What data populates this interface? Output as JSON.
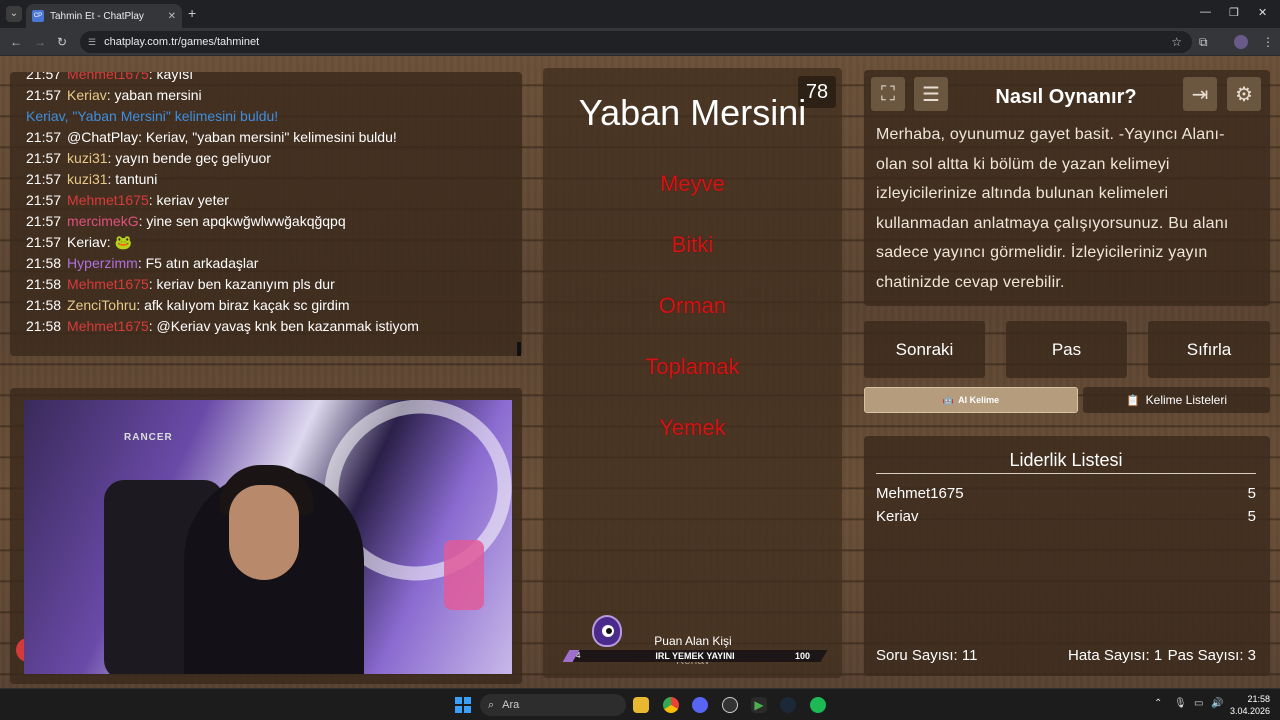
{
  "browser": {
    "tab_title": "Tahmin Et - ChatPlay",
    "favicon_text": "CP",
    "url": "chatplay.com.tr/games/tahminet"
  },
  "chat": {
    "lines": [
      {
        "time": "21:57",
        "user": "Mehmet1675",
        "user_color": "#d93b3b",
        "text": ": kayısı"
      },
      {
        "time": "21:57",
        "user": "Keriav",
        "user_color": "#e8c98a",
        "text": ": yaban mersini"
      },
      {
        "time": "",
        "user": "",
        "user_color": "#3e8fe0",
        "text": "Keriav, \"Yaban Mersini\" kelimesini buldu!",
        "highlight": "#3e8fe0"
      },
      {
        "time": "21:57",
        "user": "",
        "user_color": "#ffffff",
        "text": "@ChatPlay: Keriav, \"yaban mersini\" kelimesini buldu!"
      },
      {
        "time": "21:57",
        "user": "kuzi31",
        "user_color": "#e8c98a",
        "text": ": yayın bende geç geliyuor"
      },
      {
        "time": "21:57",
        "user": "kuzi31",
        "user_color": "#e8c98a",
        "text": ": tantuni"
      },
      {
        "time": "21:57",
        "user": "Mehmet1675",
        "user_color": "#d93b3b",
        "text": ": keriav yeter"
      },
      {
        "time": "21:57",
        "user": "mercimekG",
        "user_color": "#e05080",
        "text": ": yine sen apqkwğwlwwğakqğqpq"
      },
      {
        "time": "21:57",
        "user": "Keriav",
        "user_color": "#ffffff",
        "text": ": 🐸"
      },
      {
        "time": "21:58",
        "user": "Hyperzimm",
        "user_color": "#b070e0",
        "text": ": F5 atın arkadaşlar"
      },
      {
        "time": "21:58",
        "user": "Mehmet1675",
        "user_color": "#d93b3b",
        "text": ": keriav ben kazanıyım pls dur"
      },
      {
        "time": "21:58",
        "user": "ZenciTohru",
        "user_color": "#e8c98a",
        "text": ": afk kalıyom biraz kaçak sc girdim"
      },
      {
        "time": "21:58",
        "user": "Mehmet1675",
        "user_color": "#d93b3b",
        "text": ": @Keriav yavaş knk ben kazanmak istiyom"
      }
    ]
  },
  "camera": {
    "chair_brand": "RANCER"
  },
  "game": {
    "timer": "78",
    "word": "Yaban Mersini",
    "forbidden": [
      "Meyve",
      "Bitki",
      "Orman",
      "Toplamak",
      "Yemek"
    ],
    "forbidden_color": "#d01616",
    "scorer_label": "Puan Alan Kişi",
    "scorer_name": "Keriav",
    "bar_left": "4",
    "bar_title": "IRL YEMEK YAYINI",
    "bar_right": "100",
    "bar_progress": 0.04
  },
  "howto": {
    "title": "Nasıl Oynanır?",
    "text": "Merhaba, oyunumuz gayet basit. -Yayıncı Alanı- olan sol altta ki bölüm de yazan kelimeyi izleyicilerinize altında bulunan kelimeleri kullanmadan anlatmaya çalışıyorsunuz. Bu alanı sadece yayıncı görmelidir. İzleyicileriniz yayın chatinizde cevap verebilir."
  },
  "controls": {
    "next": "Sonraki",
    "pass": "Pas",
    "reset": "Sıfırla",
    "tab_ai": "AI Kelime",
    "tab_lists": "Kelime Listeleri"
  },
  "leaderboard": {
    "title": "Liderlik Listesi",
    "rows": [
      {
        "name": "Mehmet1675",
        "score": "5"
      },
      {
        "name": "Keriav",
        "score": "5"
      }
    ],
    "question_count": "Soru Sayısı: 11",
    "error_count": "Hata Sayısı: 1",
    "pass_count": "Pas Sayısı: 3"
  },
  "taskbar": {
    "search": "Ara",
    "time": "21:58",
    "date": "3.04.2026"
  }
}
